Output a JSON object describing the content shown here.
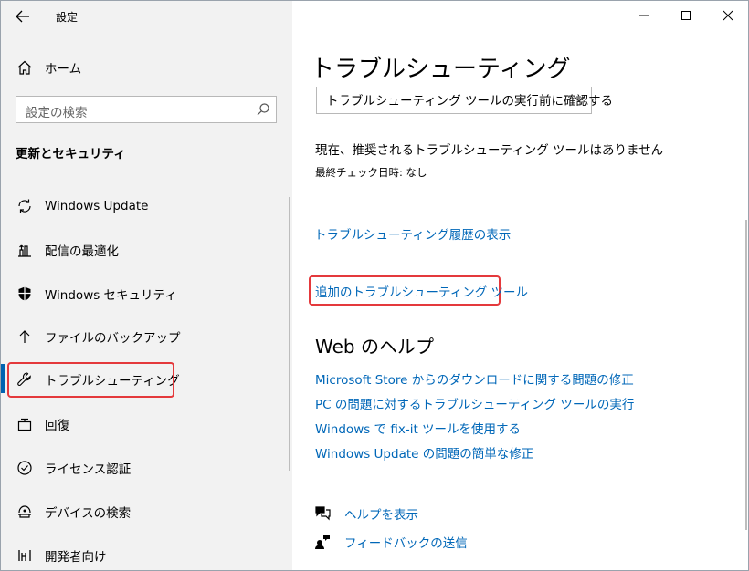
{
  "window": {
    "title": "設定",
    "back_label": "←",
    "controls": {
      "minimize": "—",
      "maximize": "☐",
      "close": "✕"
    }
  },
  "sidebar": {
    "home": "ホーム",
    "search_placeholder": "設定の検索",
    "section_title": "更新とセキュリティ",
    "items": [
      {
        "label": "Windows Update",
        "icon": "sync-icon"
      },
      {
        "label": "配信の最適化",
        "icon": "delivery-optimization-icon"
      },
      {
        "label": "Windows セキュリティ",
        "icon": "shield-icon"
      },
      {
        "label": "ファイルのバックアップ",
        "icon": "backup-arrow-icon"
      },
      {
        "label": "トラブルシューティング",
        "icon": "wrench-icon",
        "active": true
      },
      {
        "label": "回復",
        "icon": "recovery-icon"
      },
      {
        "label": "ライセンス認証",
        "icon": "check-circle-icon"
      },
      {
        "label": "デバイスの検索",
        "icon": "find-device-icon"
      },
      {
        "label": "開発者向け",
        "icon": "developer-icon"
      }
    ]
  },
  "main": {
    "title": "トラブルシューティング",
    "dropdown_value": "トラブルシューティング ツールの実行前に確認する",
    "status": "現在、推奨されるトラブルシューティング ツールはありません",
    "last_check": "最終チェック日時: なし",
    "history_link": "トラブルシューティング履歴の表示",
    "additional_link": "追加のトラブルシューティング ツール",
    "web_help_title": "Web のヘルプ",
    "web_links": [
      "Microsoft Store からのダウンロードに関する問題の修正",
      "PC の問題に対するトラブルシューティング ツールの実行",
      "Windows で fix-it ツールを使用する",
      "Windows Update の問題の簡単な修正"
    ],
    "get_help": "ヘルプを表示",
    "feedback": "フィードバックの送信"
  },
  "colors": {
    "accent": "#0063b1",
    "link": "#0067b8",
    "highlight_box": "#e4393c",
    "sidebar_bg": "#f2f2f2"
  }
}
